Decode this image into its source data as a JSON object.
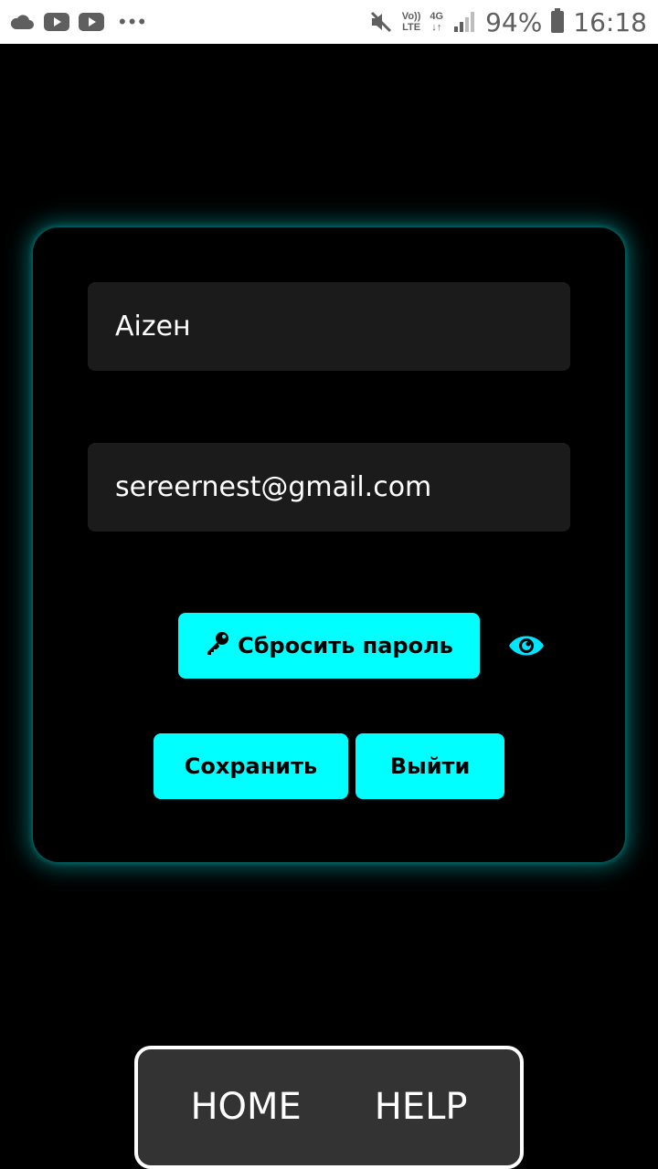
{
  "status_bar": {
    "icons_left": [
      "cloud-icon",
      "youtube-icon",
      "youtube-icon",
      "more-dots-icon"
    ],
    "more_dots": "•••",
    "volte_top": "Vo))",
    "volte_bottom": "LTE",
    "network_top": "4G",
    "network_bottom": "↓↑",
    "battery_percent": "94%",
    "time": "16:18"
  },
  "form": {
    "name_value": "Aizeн",
    "email_value": "sereernest@gmail.com",
    "reset_password_label": "Сбросить пароль",
    "save_label": "Сохранить",
    "logout_label": "Выйти"
  },
  "bottom_nav": {
    "home_label": "HOME",
    "help_label": "HELP"
  },
  "colors": {
    "accent": "#00ffff",
    "field_bg": "#1b1b1b",
    "nav_bg": "#333333",
    "background": "#000000"
  }
}
